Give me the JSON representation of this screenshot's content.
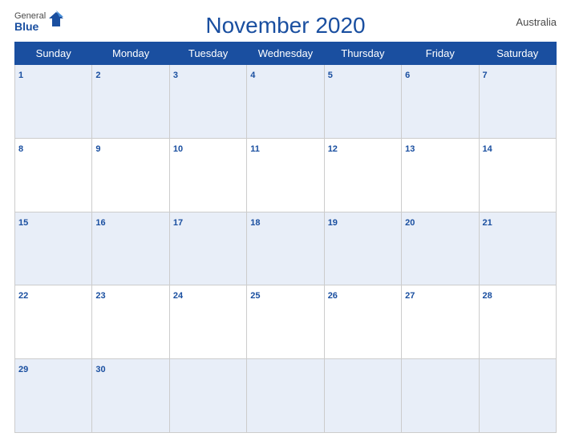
{
  "header": {
    "logo_general": "General",
    "logo_blue": "Blue",
    "title": "November 2020",
    "country": "Australia"
  },
  "days_of_week": [
    "Sunday",
    "Monday",
    "Tuesday",
    "Wednesday",
    "Thursday",
    "Friday",
    "Saturday"
  ],
  "weeks": [
    [
      {
        "day": "1",
        "empty": false
      },
      {
        "day": "2",
        "empty": false
      },
      {
        "day": "3",
        "empty": false
      },
      {
        "day": "4",
        "empty": false
      },
      {
        "day": "5",
        "empty": false
      },
      {
        "day": "6",
        "empty": false
      },
      {
        "day": "7",
        "empty": false
      }
    ],
    [
      {
        "day": "8",
        "empty": false
      },
      {
        "day": "9",
        "empty": false
      },
      {
        "day": "10",
        "empty": false
      },
      {
        "day": "11",
        "empty": false
      },
      {
        "day": "12",
        "empty": false
      },
      {
        "day": "13",
        "empty": false
      },
      {
        "day": "14",
        "empty": false
      }
    ],
    [
      {
        "day": "15",
        "empty": false
      },
      {
        "day": "16",
        "empty": false
      },
      {
        "day": "17",
        "empty": false
      },
      {
        "day": "18",
        "empty": false
      },
      {
        "day": "19",
        "empty": false
      },
      {
        "day": "20",
        "empty": false
      },
      {
        "day": "21",
        "empty": false
      }
    ],
    [
      {
        "day": "22",
        "empty": false
      },
      {
        "day": "23",
        "empty": false
      },
      {
        "day": "24",
        "empty": false
      },
      {
        "day": "25",
        "empty": false
      },
      {
        "day": "26",
        "empty": false
      },
      {
        "day": "27",
        "empty": false
      },
      {
        "day": "28",
        "empty": false
      }
    ],
    [
      {
        "day": "29",
        "empty": false
      },
      {
        "day": "30",
        "empty": false
      },
      {
        "day": "",
        "empty": true
      },
      {
        "day": "",
        "empty": true
      },
      {
        "day": "",
        "empty": true
      },
      {
        "day": "",
        "empty": true
      },
      {
        "day": "",
        "empty": true
      }
    ]
  ]
}
